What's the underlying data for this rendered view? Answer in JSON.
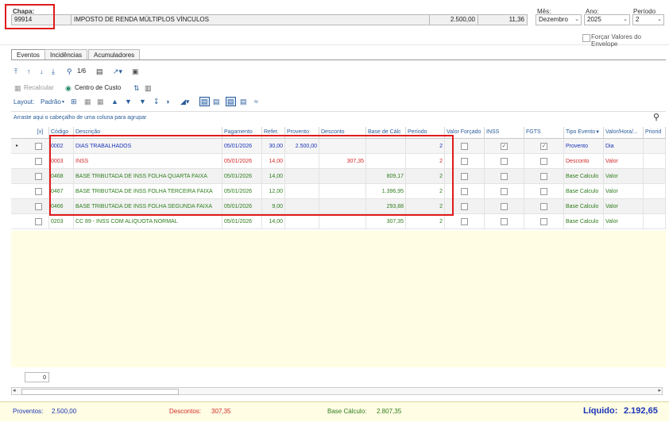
{
  "header": {
    "chapa_label": "Chapa:",
    "chapa_value": "99914",
    "description": "IMPOSTO DE RENDA MÚLTIPLOS VÍNCULOS",
    "amount1": "2.500,00",
    "amount2": "11,36",
    "mes_label": "Mês:",
    "mes_value": "Dezembro",
    "ano_label": "Ano:",
    "ano_value": "2025",
    "periodo_label": "Período",
    "periodo_value": "2",
    "forcar_label": "Forçar Valores do Envelope"
  },
  "tabs": [
    {
      "label": "Eventos"
    },
    {
      "label": "Incidências"
    },
    {
      "label": "Acumuladores"
    }
  ],
  "toolbar1": {
    "page_indicator": "1/6"
  },
  "toolbar2": {
    "recalcular": "Recalcular",
    "centro_custo": "Centro de Custo"
  },
  "toolbar3": {
    "layout_label": "Layout:",
    "layout_value": "Padrão"
  },
  "group_hint": "Arraste aqui o cabeçalho de uma coluna para agrupar",
  "columns": [
    "[x]",
    "Código",
    "Descrição",
    "Pagamento",
    "Refer.",
    "Provento",
    "Desconto",
    "Base de Cálc",
    "Período",
    "Valor Forçado",
    "INSS",
    "FGTS",
    "Tipo Evento",
    "Valor/Hora/...",
    "Priorid"
  ],
  "rows": [
    {
      "codigo": "0002",
      "descricao": "DIAS TRABALHADOS",
      "pagamento": "05/01/2026",
      "refer": "30,00",
      "provento": "2.500,00",
      "desconto": "",
      "base": "",
      "periodo": "2",
      "inss": true,
      "fgts": true,
      "tipo": "Provento",
      "valor": "Dia",
      "color": "blue"
    },
    {
      "codigo": "0003",
      "descricao": "INSS",
      "pagamento": "05/01/2026",
      "refer": "14,00",
      "provento": "",
      "desconto": "307,35",
      "base": "",
      "periodo": "2",
      "inss": false,
      "fgts": false,
      "tipo": "Desconto",
      "valor": "Valor",
      "color": "red"
    },
    {
      "codigo": "0468",
      "descricao": "BASE TRIBUTADA DE INSS FOLHA QUARTA FAIXA",
      "pagamento": "05/01/2026",
      "refer": "14,00",
      "provento": "",
      "desconto": "",
      "base": "809,17",
      "periodo": "2",
      "inss": false,
      "fgts": false,
      "tipo": "Base Calculo",
      "valor": "Valor",
      "color": "green"
    },
    {
      "codigo": "0467",
      "descricao": "BASE TRIBUTADA DE INSS FOLHA TERCEIRA FAIXA",
      "pagamento": "05/01/2026",
      "refer": "12,00",
      "provento": "",
      "desconto": "",
      "base": "1.396,95",
      "periodo": "2",
      "inss": false,
      "fgts": false,
      "tipo": "Base Calculo",
      "valor": "Valor",
      "color": "green"
    },
    {
      "codigo": "0466",
      "descricao": "BASE TRIBUTADA DE INSS FOLHA SEGUNDA FAIXA",
      "pagamento": "05/01/2026",
      "refer": "9,00",
      "provento": "",
      "desconto": "",
      "base": "293,88",
      "periodo": "2",
      "inss": false,
      "fgts": false,
      "tipo": "Base Calculo",
      "valor": "Valor",
      "color": "green"
    },
    {
      "codigo": "0203",
      "descricao": "CC 89 - INSS COM ALIQUOTA NORMAL",
      "pagamento": "05/01/2026",
      "refer": "14,00",
      "provento": "",
      "desconto": "",
      "base": "307,35",
      "periodo": "2",
      "inss": false,
      "fgts": false,
      "tipo": "Base Calculo",
      "valor": "Valor",
      "color": "green"
    }
  ],
  "record_count": "0",
  "footer": {
    "proventos_label": "Proventos:",
    "proventos_value": "2.500,00",
    "descontos_label": "Descontos:",
    "descontos_value": "307,35",
    "base_label": "Base Cálculo:",
    "base_value": "2.807,35",
    "liquido_label": "Líquido:",
    "liquido_value": "2.192,65"
  },
  "colors": {
    "accent": "#2a5d9b",
    "provento": "#1a33b5",
    "desconto": "#d42a2a",
    "base": "#2f7d1d",
    "highlight": "#e01b1b",
    "footer_bg": "#fffde3"
  }
}
